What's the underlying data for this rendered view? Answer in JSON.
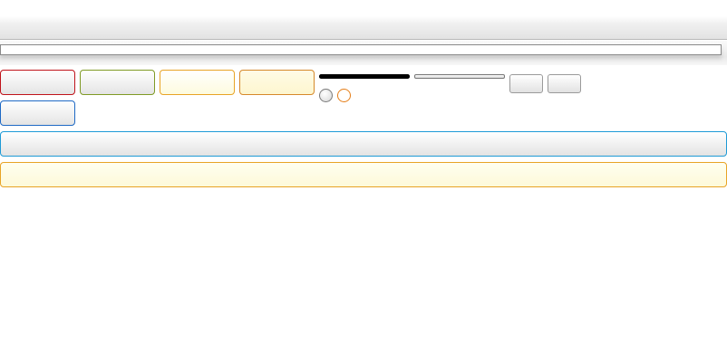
{
  "toolbar": {
    "title": ""
  },
  "address": {
    "value": "",
    "placeholder": ""
  },
  "buttons": {
    "red": "",
    "green": "",
    "yellow": "",
    "orange": "",
    "blue": "",
    "wide_blue": "",
    "wide_yellow": "",
    "small_1": "",
    "small_2": ""
  },
  "controls": {
    "progress_fraction": 1.0,
    "slider_fraction": 0.0,
    "radio_grey_checked": false,
    "radio_orange_checked": false
  },
  "colors": {
    "red_border": "#c0131a",
    "green_border": "#7f9a25",
    "yellow_border": "#e8a426",
    "orange_border": "#d6892b",
    "blue_border": "#1e69c5",
    "wide_blue_border": "#1e9ad6",
    "radio_orange": "#e57d16"
  }
}
